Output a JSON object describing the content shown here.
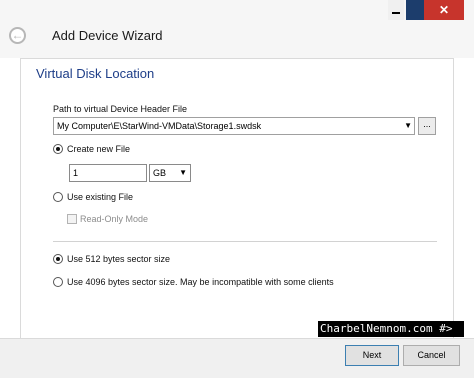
{
  "window": {
    "title": "Add Device Wizard",
    "close_glyph": "✕"
  },
  "page": {
    "section_title": "Virtual Disk Location",
    "path_label": "Path to virtual Device Header File",
    "path_value": "My Computer\\E\\StarWind-VMData\\Storage1.swdsk",
    "browse_label": "...",
    "create_new_label": "Create new File",
    "size_value": "1",
    "size_unit": "GB",
    "use_existing_label": "Use existing File",
    "read_only_label": "Read-Only Mode",
    "sector_512_label": "Use 512 bytes sector size",
    "sector_4096_label": "Use 4096 bytes sector size. May be incompatible with some clients",
    "create_new_selected": true,
    "sector_512_selected": true
  },
  "watermark": "CharbelNemnom.com #>",
  "footer": {
    "next_label": "Next",
    "cancel_label": "Cancel"
  },
  "icons": {
    "back": "back-arrow-icon",
    "dropdown": "chevron-down-icon"
  }
}
